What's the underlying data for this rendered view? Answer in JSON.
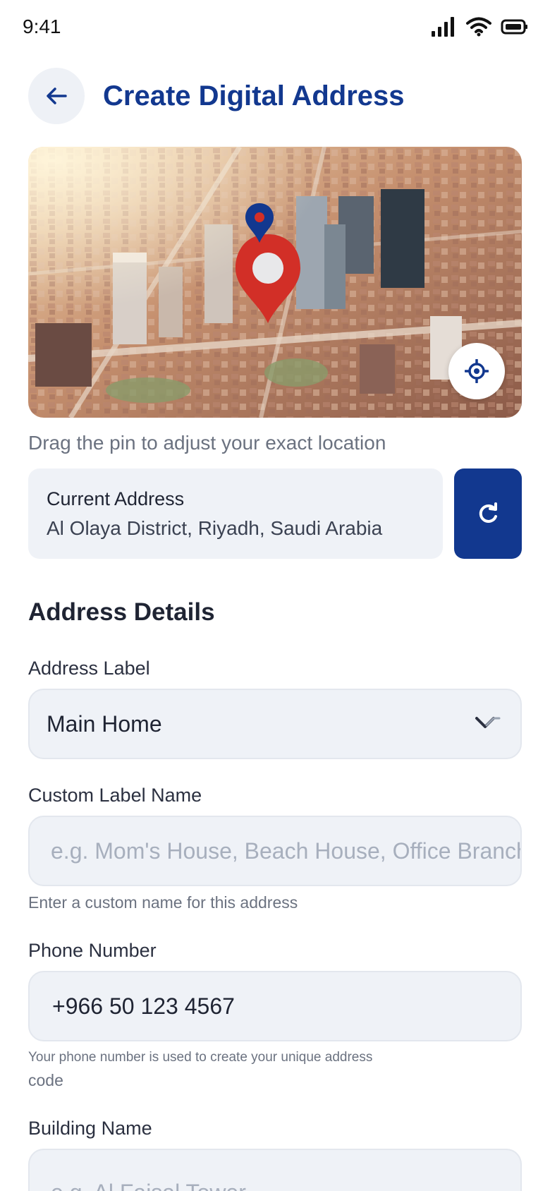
{
  "status_bar": {
    "time": "9:41"
  },
  "header": {
    "title": "Create Digital Address"
  },
  "map": {
    "hint": "Drag the pin to adjust your exact location"
  },
  "current_address": {
    "title": "Current Address",
    "value": "Al Olaya District, Riyadh, Saudi Arabia"
  },
  "section": {
    "title": "Address Details"
  },
  "fields": {
    "address_label": {
      "label": "Address Label",
      "value": "Main Home"
    },
    "custom_label": {
      "label": "Custom Label Name",
      "placeholder": "e.g. Mom's House, Beach House, Office Branch",
      "helper": "Enter a custom name for this address"
    },
    "phone": {
      "label": "Phone Number",
      "value": "+966 50 123 4567",
      "helper_line1": "Your phone number is used to create your unique address",
      "helper_line2": "code"
    },
    "building": {
      "label": "Building Name",
      "placeholder": "e.g. Al Faisal Tower"
    }
  },
  "colors": {
    "primary": "#12388f",
    "pin": "#d22f27",
    "field_bg": "#eff2f7"
  },
  "icons": [
    "back-arrow-icon",
    "signal-icon",
    "wifi-icon",
    "battery-icon",
    "map-pin-icon",
    "crosshair-icon",
    "refresh-icon",
    "chevron-down-icon"
  ]
}
